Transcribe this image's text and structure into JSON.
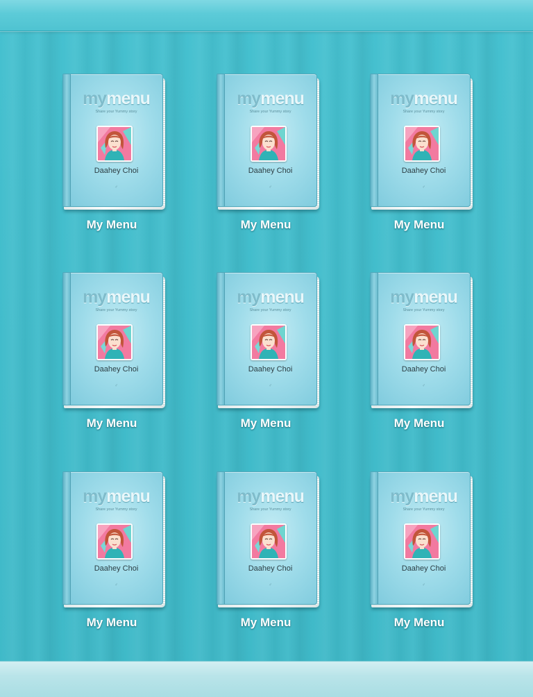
{
  "app": {
    "logo_my": "my",
    "logo_menu": "menu"
  },
  "books": [
    {
      "title": "My Menu",
      "author": "Daahey Choi",
      "tagline": "Share your Yummy story",
      "mark": "♂"
    },
    {
      "title": "My Menu",
      "author": "Daahey Choi",
      "tagline": "Share your Yummy story",
      "mark": "♂"
    },
    {
      "title": "My Menu",
      "author": "Daahey Choi",
      "tagline": "Share your Yummy story",
      "mark": "♂"
    },
    {
      "title": "My Menu",
      "author": "Daahey Choi",
      "tagline": "Share your Yummy story",
      "mark": "♂"
    },
    {
      "title": "My Menu",
      "author": "Daahey Choi",
      "tagline": "Share your Yummy story",
      "mark": "♂"
    },
    {
      "title": "My Menu",
      "author": "Daahey Choi",
      "tagline": "Share your Yummy story",
      "mark": "♂"
    },
    {
      "title": "My Menu",
      "author": "Daahey Choi",
      "tagline": "Share your Yummy story",
      "mark": "♂"
    },
    {
      "title": "My Menu",
      "author": "Daahey Choi",
      "tagline": "Share your Yummy story",
      "mark": "♂"
    },
    {
      "title": "My Menu",
      "author": "Daahey Choi",
      "tagline": "Share your Yummy story",
      "mark": "♂"
    }
  ],
  "icons": {
    "avatar": "user-avatar-icon"
  },
  "colors": {
    "background": "#45c0cf",
    "cover": "#9fdcea",
    "title_text": "#ffffff",
    "author_text": "#2c3e44"
  }
}
